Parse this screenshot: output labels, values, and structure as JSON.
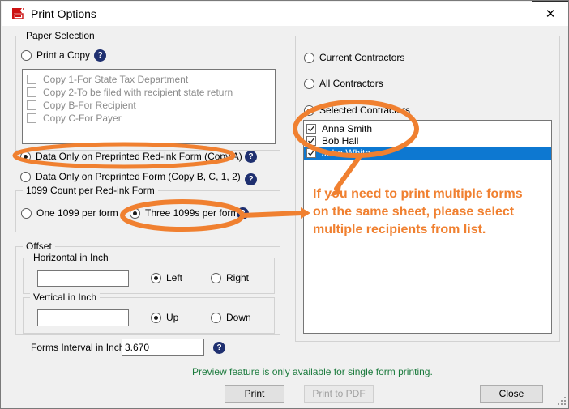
{
  "window": {
    "title": "Print Options",
    "icon": "printer-icon",
    "close_label": "✕"
  },
  "paper_selection": {
    "legend": "Paper Selection",
    "print_a_copy": {
      "label": "Print a Copy",
      "checked": false
    },
    "help_label": "?",
    "copies": [
      {
        "label": "Copy 1-For State Tax Department",
        "checked": false
      },
      {
        "label": "Copy 2-To be filed with recipient state return",
        "checked": false
      },
      {
        "label": "Copy B-For Recipient",
        "checked": false
      },
      {
        "label": "Copy C-For Payer",
        "checked": false
      }
    ]
  },
  "data_only": {
    "red_ink": {
      "label": "Data Only on Preprinted Red-ink Form (Copy A)",
      "checked": true
    },
    "plain": {
      "label": "Data Only on Preprinted  Form (Copy B, C, 1, 2)",
      "checked": false
    },
    "help_label": "?"
  },
  "count_group": {
    "legend": "1099 Count per Red-ink Form",
    "one": {
      "label": "One 1099 per form",
      "checked": false
    },
    "three": {
      "label": "Three 1099s per form",
      "checked": true
    },
    "help_label": "?"
  },
  "offset": {
    "legend": "Offset",
    "horizontal": {
      "legend": "Horizontal in Inch",
      "value": "",
      "placeholder": "",
      "left": {
        "label": "Left",
        "checked": true
      },
      "right": {
        "label": "Right",
        "checked": false
      }
    },
    "vertical": {
      "legend": "Vertical in Inch",
      "value": "",
      "placeholder": "",
      "up": {
        "label": "Up",
        "checked": true
      },
      "down": {
        "label": "Down",
        "checked": false
      }
    }
  },
  "forms_interval": {
    "label": "Forms Interval in Inch:",
    "value": "3.670",
    "help_label": "?"
  },
  "contractors": {
    "current": {
      "label": "Current Contractors",
      "checked": false
    },
    "all": {
      "label": "All Contractors",
      "checked": false
    },
    "selected": {
      "label": "Selected Contractors",
      "checked": true
    },
    "list": [
      {
        "label": "Anna Smith",
        "checked": true,
        "highlighted": false
      },
      {
        "label": "Bob Hall",
        "checked": true,
        "highlighted": false
      },
      {
        "label": "John White",
        "checked": true,
        "highlighted": true
      }
    ]
  },
  "annotation": {
    "text": "If you need to print multiple forms on the same sheet, please select multiple recipients from list.",
    "color": "#f08030"
  },
  "footer": {
    "preview_note": "Preview feature is only available for single form printing.",
    "print_label": "Print",
    "print_pdf_label": "Print to PDF",
    "print_pdf_disabled": true,
    "close_label": "Close"
  },
  "colors": {
    "accent_orange": "#f08030",
    "selection_blue": "#0d78d1",
    "note_green": "#1a7a3c",
    "help_navy": "#1f3070"
  }
}
